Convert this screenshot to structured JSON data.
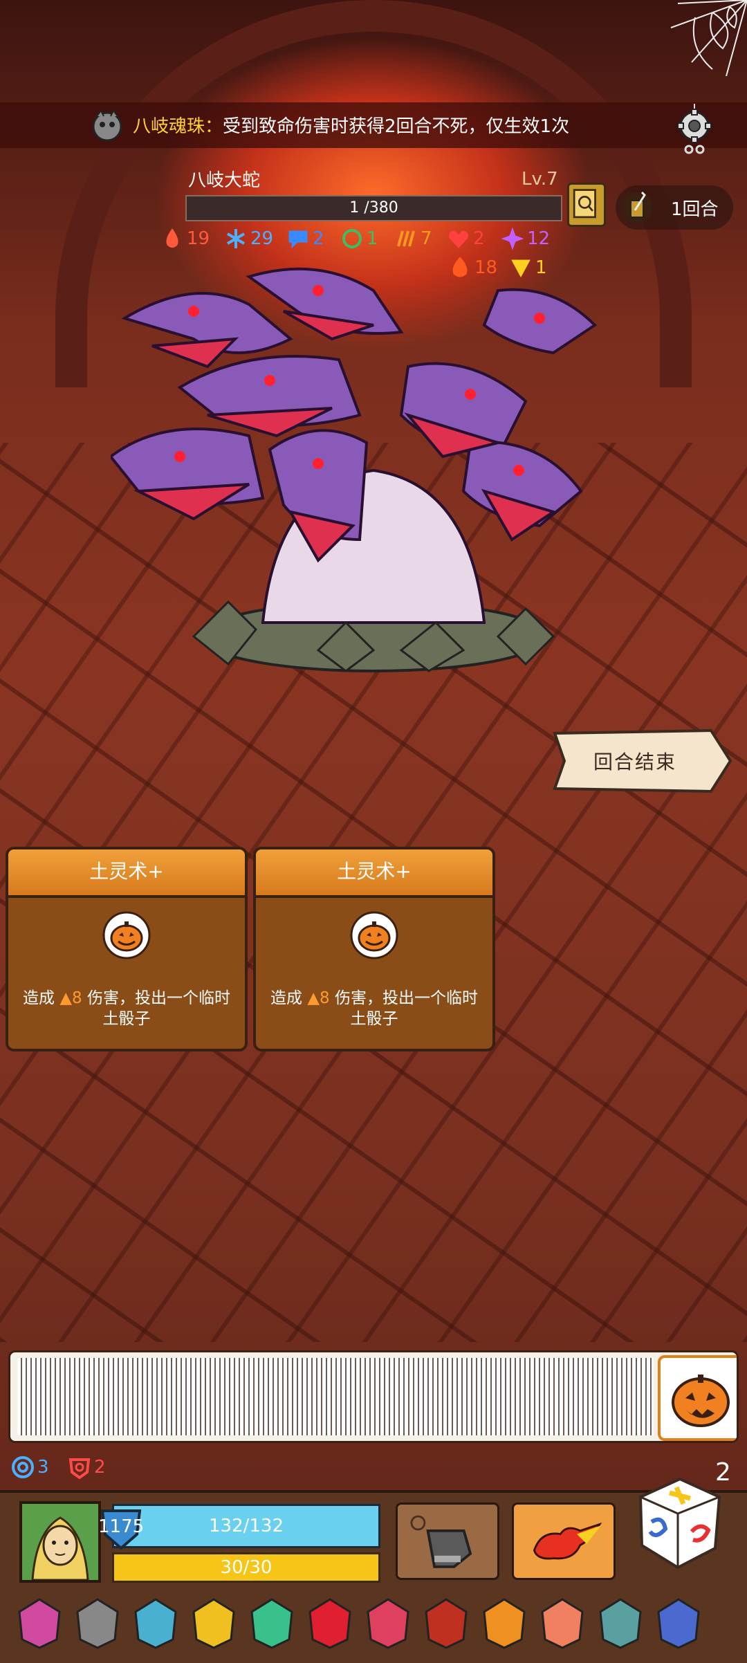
{
  "relic_bar": {
    "name": "八岐魂珠：",
    "text": "受到致命伤害时获得2回合不死，仅生效1次"
  },
  "enemy": {
    "name": "八岐大蛇",
    "level": "Lv.7",
    "hp_text": "1 /380",
    "hp_fraction": 0.003
  },
  "round": {
    "label": "1回合"
  },
  "status_effects": [
    {
      "icon": "fire-drop-icon",
      "value": "19",
      "color": "#ff5a3a"
    },
    {
      "icon": "snowflake-icon",
      "value": "29",
      "color": "#4ab0ff"
    },
    {
      "icon": "speech-bubble-icon",
      "value": "2",
      "color": "#3a8aff"
    },
    {
      "icon": "poison-swirl-icon",
      "value": "1",
      "color": "#3ac060"
    },
    {
      "icon": "claw-icon",
      "value": "7",
      "color": "#ff9a20"
    },
    {
      "icon": "broken-heart-icon",
      "value": "2",
      "color": "#ff4040"
    },
    {
      "icon": "sparkle-icon",
      "value": "12",
      "color": "#c060ff"
    },
    {
      "icon": "flame-icon",
      "value": "18",
      "color": "#ff5a20"
    },
    {
      "icon": "triangle-rune-icon",
      "value": "1",
      "color": "#ffd020"
    }
  ],
  "end_turn": {
    "label": "回合结束"
  },
  "cards": [
    {
      "title": "土灵术+",
      "desc_prefix": "造成",
      "damage": "8",
      "desc_suffix": "伤害，投出一个临时土骰子",
      "emblem": "pumpkin-icon"
    },
    {
      "title": "土灵术+",
      "desc_prefix": "造成",
      "damage": "8",
      "desc_suffix": "伤害，投出一个临时土骰子",
      "emblem": "pumpkin-icon"
    }
  ],
  "deck": {
    "top_icon": "pumpkin-icon"
  },
  "counters": {
    "draw": "3",
    "discard": "2",
    "dice": "2"
  },
  "player": {
    "shield": "1175",
    "hp": "132/132",
    "energy": "30/30"
  },
  "relic_icons": [
    "totem-icon",
    "stone-golem-icon",
    "sapphire-helm-icon",
    "crown-icon",
    "emerald-orb-icon",
    "ruby-icon",
    "pendant-icon",
    "demon-mask-icon",
    "flame-crown-icon",
    "donut-ring-icon",
    "jade-vase-icon",
    "blue-slime-icon"
  ],
  "colors": {
    "hp_bar": "#6ad0f0",
    "energy_bar": "#f5c518",
    "card_header": "#e8912a",
    "relic_name": "#ffd23a"
  }
}
